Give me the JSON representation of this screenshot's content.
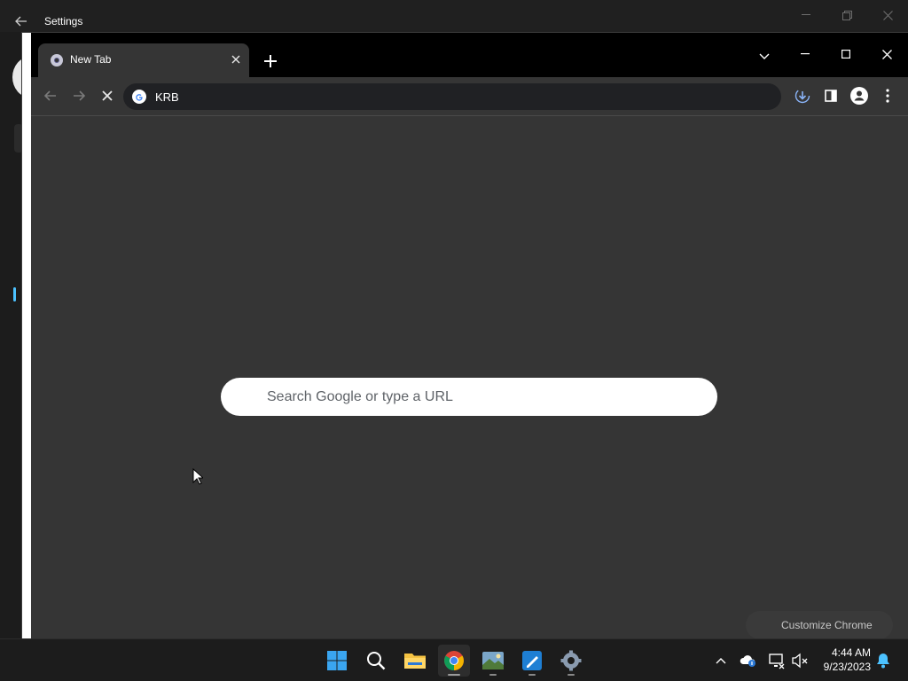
{
  "settings": {
    "title": "Settings"
  },
  "chrome": {
    "tab": {
      "title": "New Tab"
    },
    "omnibox": {
      "text": "KRB"
    },
    "ntp": {
      "search_placeholder": "Search Google or type a URL"
    },
    "customize_label": "Customize Chrome"
  },
  "taskbar": {
    "time": "4:44 AM",
    "date": "9/23/2023",
    "apps": [
      "start",
      "search",
      "file-explorer",
      "chrome",
      "photos",
      "whiteboard",
      "settings"
    ]
  },
  "colors": {
    "accent": "#4cc2ff",
    "chrome_bg": "#353535",
    "tab_strip": "#000000"
  }
}
